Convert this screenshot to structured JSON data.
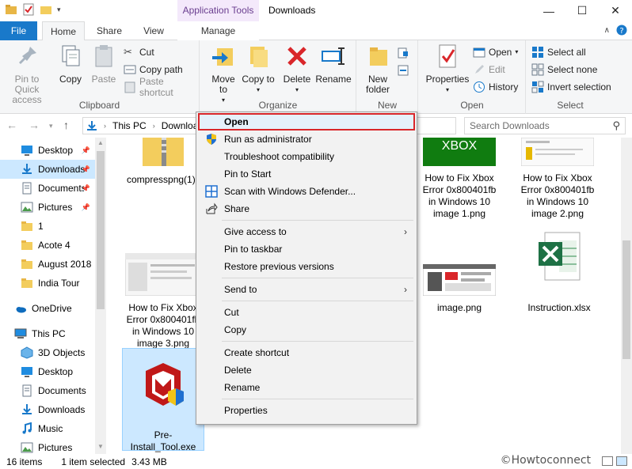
{
  "window": {
    "title": "Downloads",
    "contextual_tab_title": "Application Tools"
  },
  "tabs": {
    "file": "File",
    "home": "Home",
    "share": "Share",
    "view": "View",
    "manage": "Manage"
  },
  "ribbon": {
    "clipboard": {
      "label": "Clipboard",
      "pin": "Pin to Quick access",
      "copy": "Copy",
      "paste": "Paste",
      "cut": "Cut",
      "copy_path": "Copy path",
      "paste_shortcut": "Paste shortcut"
    },
    "organize": {
      "label": "Organize",
      "move_to": "Move to",
      "copy_to": "Copy to",
      "delete": "Delete",
      "rename": "Rename"
    },
    "new": {
      "label": "New",
      "new_folder": "New folder"
    },
    "open": {
      "label": "Open",
      "properties": "Properties",
      "open": "Open",
      "edit": "Edit",
      "history": "History"
    },
    "select": {
      "label": "Select",
      "select_all": "Select all",
      "select_none": "Select none",
      "invert": "Invert selection"
    }
  },
  "address": {
    "this_pc": "This PC",
    "current": "Downloads",
    "search_placeholder": "Search Downloads"
  },
  "nav": {
    "items": [
      {
        "label": "Desktop",
        "pinned": true
      },
      {
        "label": "Downloads",
        "pinned": true
      },
      {
        "label": "Documents",
        "pinned": true
      },
      {
        "label": "Pictures",
        "pinned": true
      },
      {
        "label": "1"
      },
      {
        "label": "Acote 4"
      },
      {
        "label": "August 2018"
      },
      {
        "label": "India Tour"
      },
      {
        "label": "OneDrive"
      },
      {
        "label": "This PC"
      },
      {
        "label": "3D Objects"
      },
      {
        "label": "Desktop"
      },
      {
        "label": "Documents"
      },
      {
        "label": "Downloads"
      },
      {
        "label": "Music"
      },
      {
        "label": "Pictures"
      }
    ]
  },
  "files": [
    {
      "name": "compresspng(1).zip"
    },
    {
      "name": "How to Fix Xbox Error 0x800401fb in Windows 10 image 1.png"
    },
    {
      "name": "How to Fix Xbox Error 0x800401fb in Windows 10 image 2.png"
    },
    {
      "name": "How to Fix Xbox Error 0x800401fb in Windows 10 image 3.png"
    },
    {
      "name": "image.png"
    },
    {
      "name": "Instruction.xlsx"
    },
    {
      "name": "Pre-Install_Tool.exe"
    }
  ],
  "thumb_text": {
    "xbox": "XBOX"
  },
  "context_menu": {
    "open": "Open",
    "run_as_admin": "Run as administrator",
    "troubleshoot": "Troubleshoot compatibility",
    "pin_start": "Pin to Start",
    "scan_defender": "Scan with Windows Defender...",
    "share": "Share",
    "give_access": "Give access to",
    "pin_taskbar": "Pin to taskbar",
    "restore_versions": "Restore previous versions",
    "send_to": "Send to",
    "cut": "Cut",
    "copy": "Copy",
    "create_shortcut": "Create shortcut",
    "delete": "Delete",
    "rename": "Rename",
    "properties": "Properties"
  },
  "status": {
    "count": "16 items",
    "selected": "1 item selected",
    "size": "3.43 MB"
  },
  "watermark": "©Howtoconnect",
  "colors": {
    "accent": "#1979ca",
    "selection": "#cce8ff",
    "highlight_border": "#d9262a",
    "contextual_tab": "#f4e9fb"
  }
}
